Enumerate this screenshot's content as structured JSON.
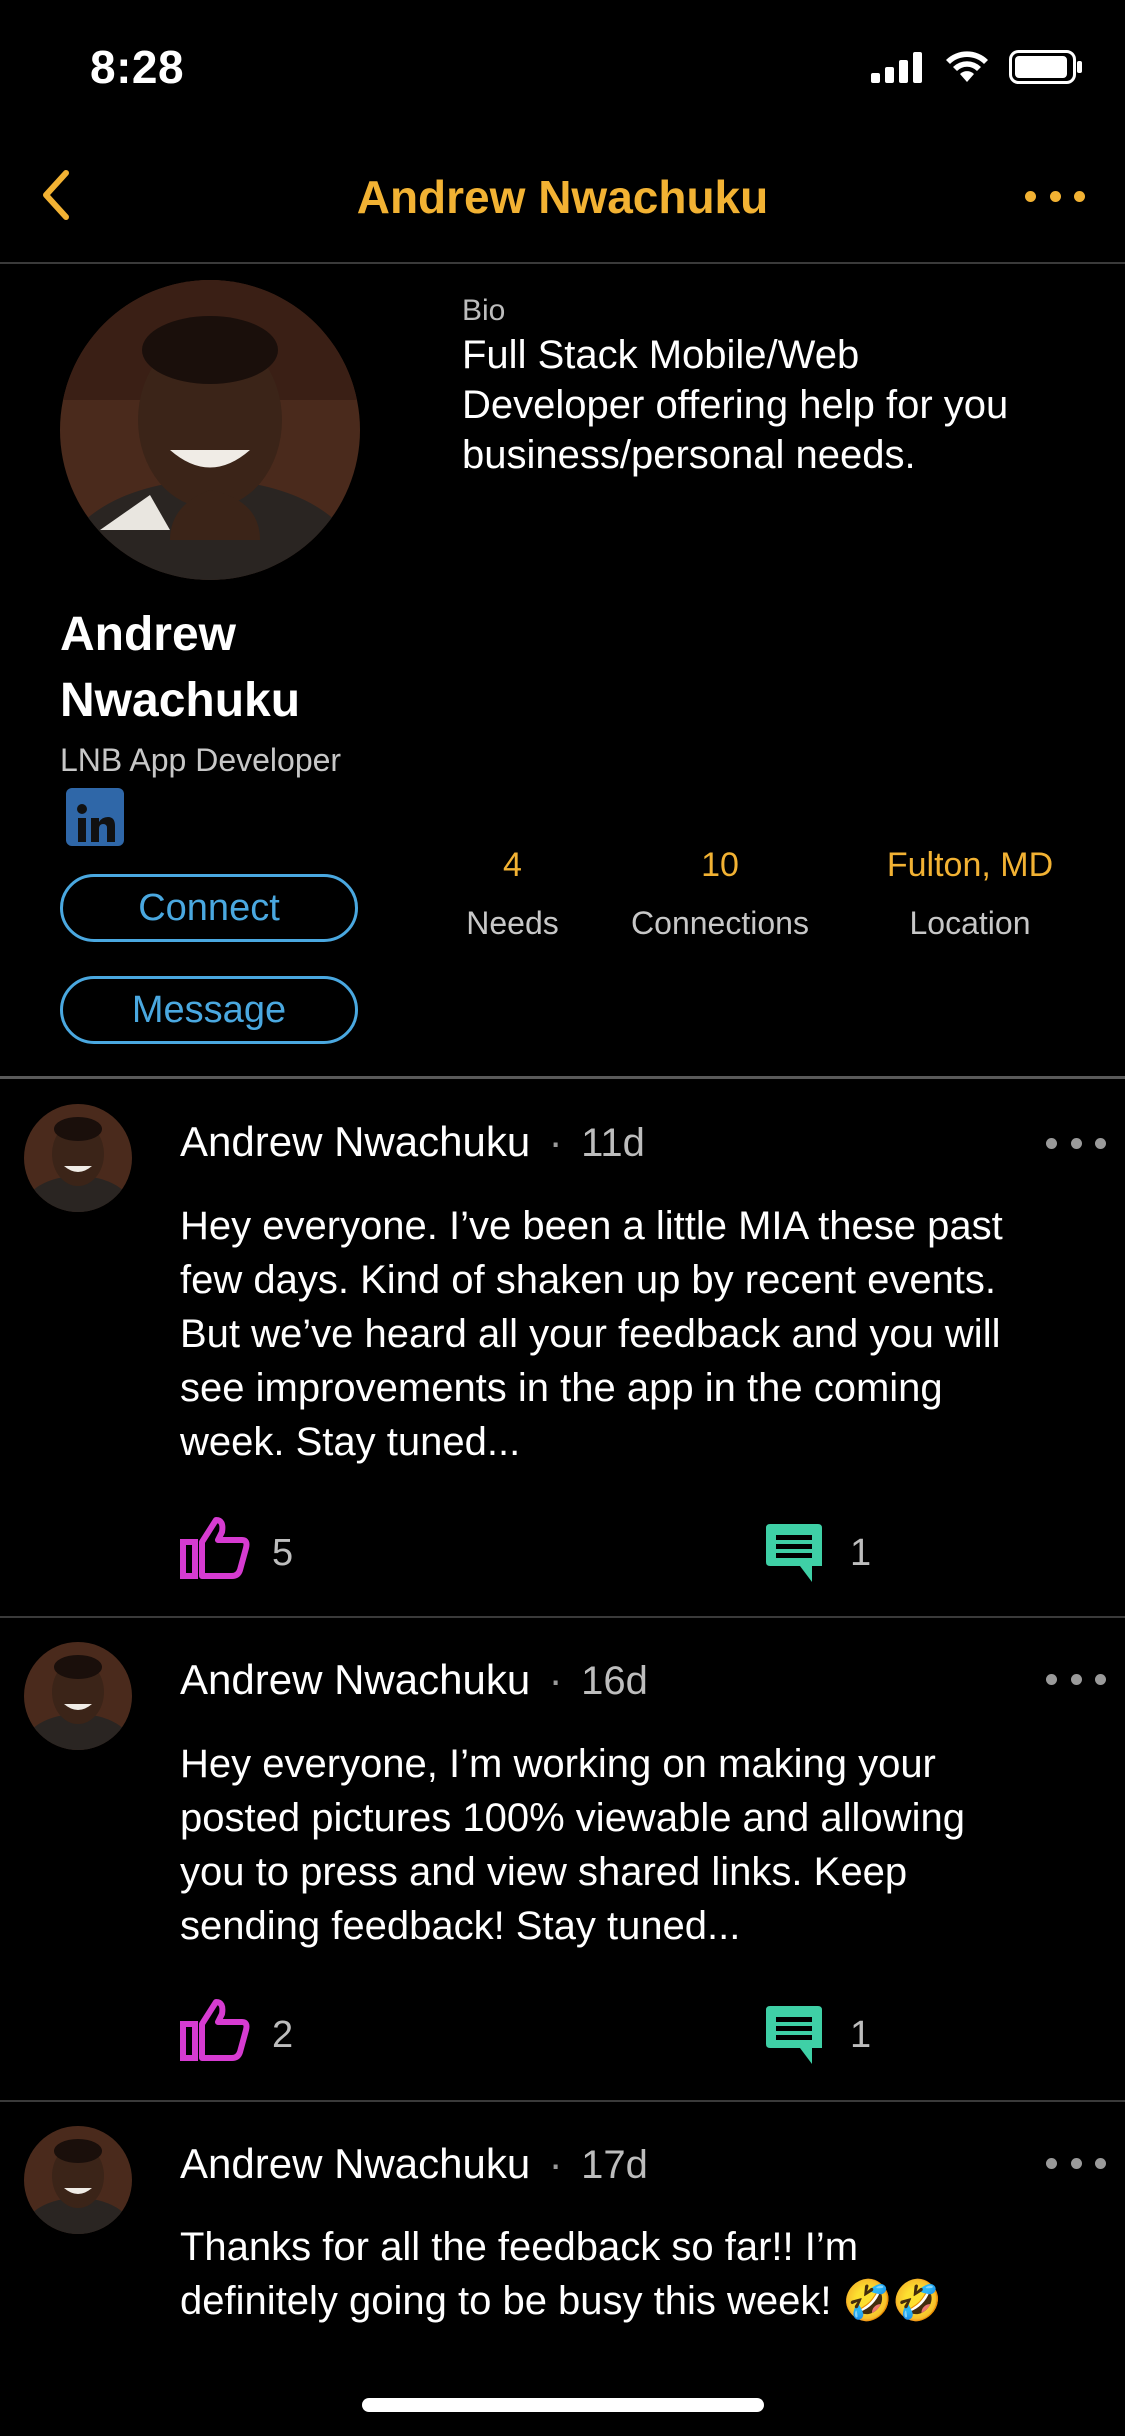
{
  "status_bar": {
    "time": "8:28"
  },
  "nav": {
    "title": "Andrew Nwachuku"
  },
  "profile": {
    "name_line1": "Andrew",
    "name_line2": "Nwachuku",
    "role": "LNB App Developer",
    "bio_label": "Bio",
    "bio_lines": [
      "Full Stack Mobile/Web",
      "Developer offering help for you",
      "business/personal needs."
    ],
    "connect_label": "Connect",
    "message_label": "Message",
    "stats": [
      {
        "value": "4",
        "label": "Needs"
      },
      {
        "value": "10",
        "label": "Connections"
      },
      {
        "value": "Fulton, MD",
        "label": "Location"
      }
    ]
  },
  "posts": [
    {
      "author": "Andrew Nwachuku",
      "separator": "·",
      "time": "11d",
      "lines": [
        "Hey everyone. I’ve been a little MIA these past",
        "few days. Kind of shaken up by recent events.",
        "But we’ve heard all your feedback and you will",
        "see improvements in the app in the coming",
        "week. Stay tuned..."
      ],
      "likes": "5",
      "comments": "1"
    },
    {
      "author": "Andrew Nwachuku",
      "separator": "·",
      "time": "16d",
      "lines": [
        "Hey everyone, I’m working on making your",
        "posted pictures 100% viewable and allowing",
        "you to press and view shared links. Keep",
        "sending feedback! Stay tuned..."
      ],
      "likes": "2",
      "comments": "1"
    },
    {
      "author": "Andrew Nwachuku",
      "separator": "·",
      "time": "17d",
      "lines": [
        "Thanks for all the feedback so far!! I’m",
        "definitely going to be busy this week! 🤣🤣"
      ]
    }
  ],
  "colors": {
    "accent": "#f2b233",
    "button": "#4aa8e0",
    "like": "#d63bd1",
    "comment": "#3fd0a6",
    "linkedin": "#2f67a8"
  },
  "icons": [
    "back-chevron-icon",
    "more-icon",
    "linkedin-icon",
    "thumbs-up-icon",
    "comment-icon",
    "signal-icon",
    "wifi-icon",
    "battery-icon"
  ]
}
